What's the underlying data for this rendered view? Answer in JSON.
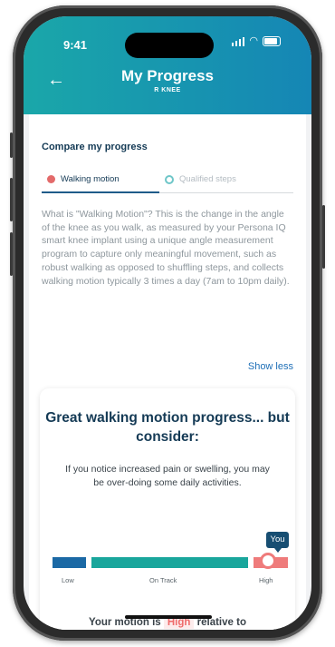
{
  "status": {
    "time": "9:41"
  },
  "header": {
    "title": "My Progress",
    "subtitle": "R KNEE",
    "back_icon": "arrow-left-icon"
  },
  "compare": {
    "title": "Compare my progress",
    "tabs": [
      {
        "label": "Walking motion",
        "active": true,
        "dot_color": "#e36a6a"
      },
      {
        "label": "Qualified steps",
        "active": false,
        "dot_color": "#6ec6c8"
      }
    ],
    "description": "What is \"Walking Motion\"? This is the change in the angle of the knee as you walk, as measured by your Persona IQ smart knee implant using a unique angle measurement program to capture only meaningful movement, such as robust walking as opposed to shuffling steps, and collects walking motion typically 3 times a day (7am to 10pm daily).",
    "show_less": "Show less"
  },
  "insight": {
    "heading": "Great walking motion progress... but consider:",
    "body": "If you notice increased pain or swelling, you may be over-doing some daily activities.",
    "you_label": "You",
    "range_labels": {
      "low": "Low",
      "on_track": "On Track",
      "high": "High"
    },
    "current_level": "High",
    "motion_prefix": "Your motion is",
    "motion_value": "High",
    "motion_suffix": "relative to"
  },
  "colors": {
    "header_start": "#1aa7a9",
    "header_end": "#1586b5",
    "low": "#1b69a5",
    "on_track": "#19a69c",
    "high": "#ef7b7b",
    "link": "#1e6fb7",
    "heading": "#143a55"
  }
}
